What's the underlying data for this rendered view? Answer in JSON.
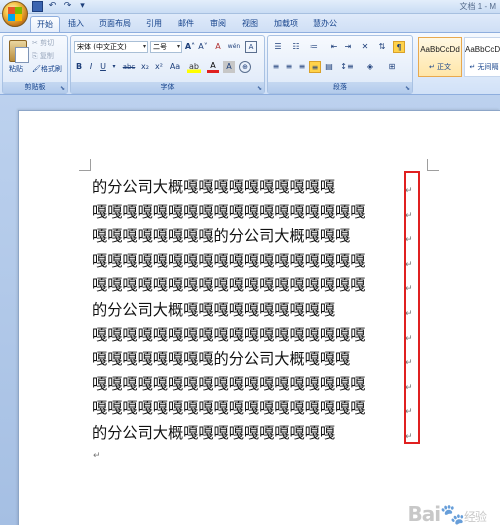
{
  "title_bar": {
    "title": "文档 1 - M"
  },
  "quick_access": {
    "undo_icon": "undo-icon",
    "redo_icon": "redo-icon",
    "save_icon": "save-icon"
  },
  "tabs": [
    "开始",
    "插入",
    "页面布局",
    "引用",
    "邮件",
    "审阅",
    "视图",
    "加载项",
    "慧办公"
  ],
  "active_tab": "开始",
  "clipboard": {
    "label": "剪贴板",
    "paste": "粘贴",
    "cut": "剪切",
    "copy": "复制",
    "format_painter": "格式刷"
  },
  "font": {
    "label": "字体",
    "font_name": "宋体 (中文正文)",
    "font_size": "二号",
    "bold": "B",
    "italic": "I",
    "underline": "U",
    "strike": "abc",
    "subscript": "x₂",
    "superscript": "x²",
    "change_case": "Aa",
    "grow": "A˄",
    "shrink": "A˅",
    "clear": "A",
    "phonetic": "wén",
    "border_char": "A",
    "font_color": "A",
    "char_shading": "A"
  },
  "paragraph": {
    "label": "段落"
  },
  "styles": {
    "items": [
      {
        "sample": "AaBbCcDd",
        "name": "正文"
      },
      {
        "sample": "AaBbCcDc",
        "name": "无间隔"
      }
    ]
  },
  "document": {
    "lines": [
      "的分公司大概嘎嘎嘎嘎嘎嘎嘎嘎嘎嘎",
      "嘎嘎嘎嘎嘎嘎嘎嘎嘎嘎嘎嘎嘎嘎嘎嘎嘎嘎",
      "嘎嘎嘎嘎嘎嘎嘎嘎的分公司大概嘎嘎嘎",
      "嘎嘎嘎嘎嘎嘎嘎嘎嘎嘎嘎嘎嘎嘎嘎嘎嘎嘎",
      "嘎嘎嘎嘎嘎嘎嘎嘎嘎嘎嘎嘎嘎嘎嘎嘎嘎嘎",
      "的分公司大概嘎嘎嘎嘎嘎嘎嘎嘎嘎嘎",
      "嘎嘎嘎嘎嘎嘎嘎嘎嘎嘎嘎嘎嘎嘎嘎嘎嘎嘎",
      "嘎嘎嘎嘎嘎嘎嘎嘎的分公司大概嘎嘎嘎",
      "嘎嘎嘎嘎嘎嘎嘎嘎嘎嘎嘎嘎嘎嘎嘎嘎嘎嘎",
      "嘎嘎嘎嘎嘎嘎嘎嘎嘎嘎嘎嘎嘎嘎嘎嘎嘎嘎",
      "的分公司大概嘎嘎嘎嘎嘎嘎嘎嘎嘎嘎"
    ],
    "paragraph_mark": "↵",
    "highlight_color": "#e02020"
  },
  "watermark": {
    "text": "Bai",
    "suffix": "经验"
  }
}
